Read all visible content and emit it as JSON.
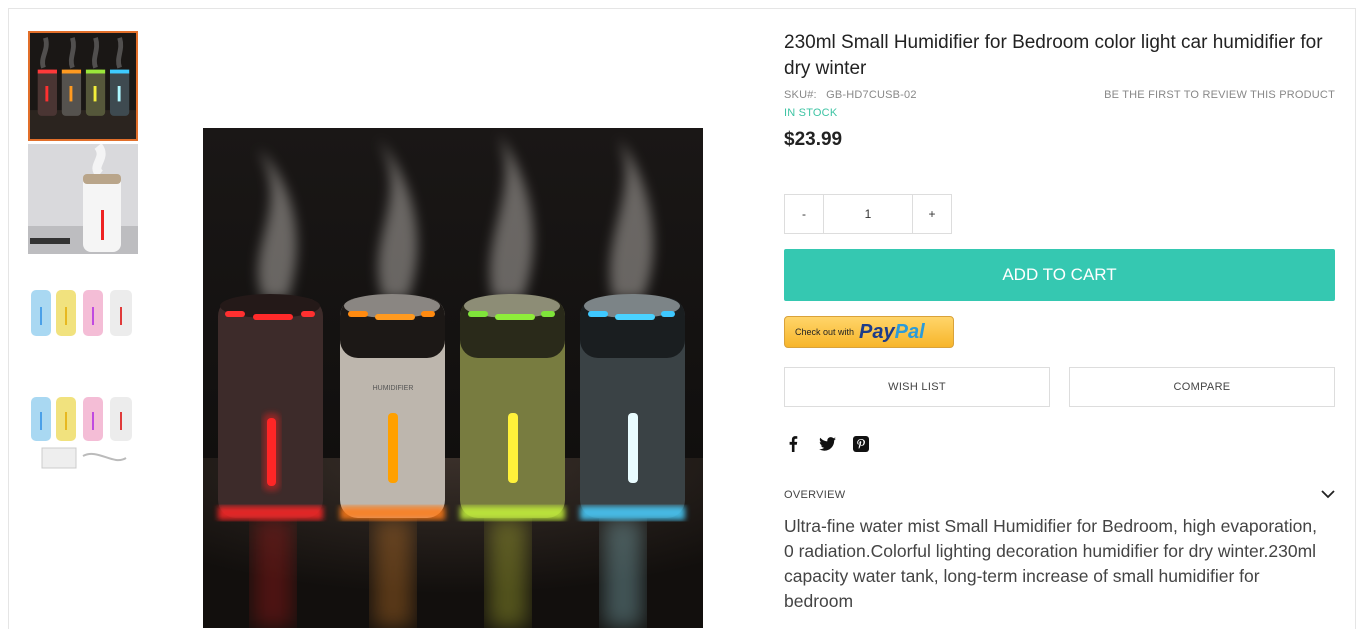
{
  "product": {
    "title": "230ml Small Humidifier for Bedroom color light car humidifier for dry winter",
    "sku_label": "SKU#:",
    "sku_value": "GB-HD7CUSB-02",
    "review_link": "BE THE FIRST TO REVIEW THIS PRODUCT",
    "stock_status": "IN STOCK",
    "price": "$23.99"
  },
  "quantity": {
    "minus_label": "-",
    "value": "1",
    "plus_label": "+"
  },
  "actions": {
    "add_to_cart": "ADD TO CART",
    "paypal_prefix": "Check out with",
    "paypal_pay": "Pay",
    "paypal_pal": "Pal",
    "wish_list": "WISH LIST",
    "compare": "COMPARE"
  },
  "social": [
    "facebook-icon",
    "twitter-icon",
    "pinterest-icon"
  ],
  "overview": {
    "label": "OVERVIEW",
    "text": "Ultra-fine water mist Small Humidifier for Bedroom, high evaporation, 0 radiation.Colorful lighting decoration humidifier for dry winter.230ml capacity water tank, long-term increase of small humidifier for bedroom"
  },
  "gallery": {
    "thumbnails": [
      "four-humidifiers-lit",
      "white-humidifier-single",
      "five-pastel-humidifiers",
      "pastel-humidifiers-with-accessories"
    ],
    "active_index": 0,
    "main_image_label": "HUMIDIFIER"
  },
  "colors": {
    "accent": "#35c8b1",
    "stock": "#3ec4a4",
    "active_thumb_border": "#e26f2a"
  }
}
